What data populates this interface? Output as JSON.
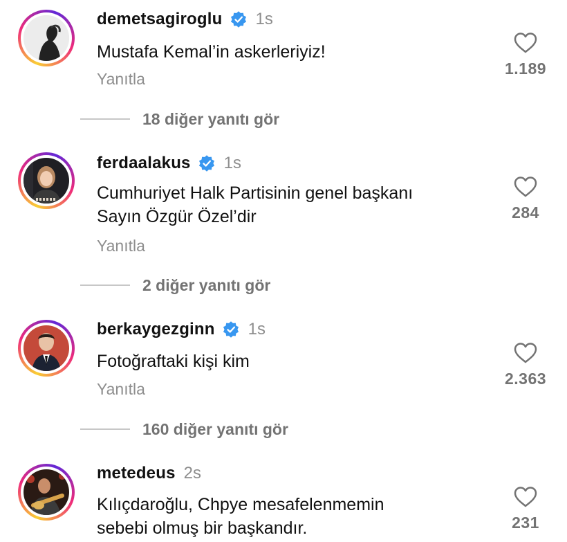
{
  "comments": [
    {
      "username": "demetsagiroglu",
      "verified": true,
      "time": "1s",
      "text": "Mustafa Kemal’in askerleriyiz!",
      "reply_label": "Yanıtla",
      "likes": "1.189",
      "more_replies": "18 diğer yanıtı gör"
    },
    {
      "username": "ferdaalakus",
      "verified": true,
      "time": "1s",
      "text_lines": [
        "Cumhuriyet Halk Partisinin genel başkanı",
        "Sayın Özgür Özel’dir"
      ],
      "reply_label": "Yanıtla",
      "likes": "284",
      "more_replies": "2 diğer yanıtı gör"
    },
    {
      "username": "berkaygezginn",
      "verified": true,
      "time": "1s",
      "text": "Fotoğraftaki kişi kim",
      "reply_label": "Yanıtla",
      "likes": "2.363",
      "more_replies": "160 diğer yanıtı gör"
    },
    {
      "username": "metedeus",
      "verified": false,
      "time": "2s",
      "text_lines": [
        "Kılıçdaroğlu, Chpye mesafelenmemin",
        "sebebi olmuş bir başkandır."
      ],
      "likes": "231"
    }
  ],
  "colors": {
    "verified_badge": "#3897f0",
    "muted_text": "#8e8e8e",
    "story_ring": [
      "#f9ce34",
      "#ee2a7b",
      "#6228d7"
    ]
  },
  "icons": [
    "verified-badge-icon",
    "heart-icon"
  ]
}
